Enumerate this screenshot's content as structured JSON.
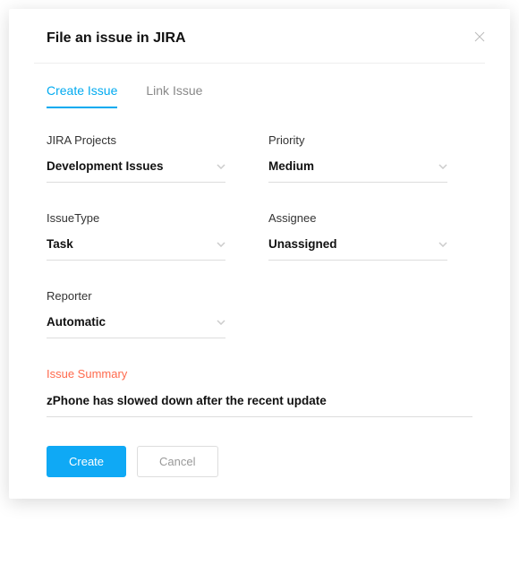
{
  "header": {
    "title": "File an issue in JIRA"
  },
  "tabs": {
    "create": "Create Issue",
    "link": "Link Issue"
  },
  "fields": {
    "projects": {
      "label": "JIRA Projects",
      "value": "Development Issues"
    },
    "priority": {
      "label": "Priority",
      "value": "Medium"
    },
    "issuetype": {
      "label": "IssueType",
      "value": "Task"
    },
    "assignee": {
      "label": "Assignee",
      "value": "Unassigned"
    },
    "reporter": {
      "label": "Reporter",
      "value": "Automatic"
    }
  },
  "summary": {
    "label": "Issue Summary",
    "value": "zPhone has slowed down after the recent update"
  },
  "actions": {
    "create": "Create",
    "cancel": "Cancel"
  }
}
